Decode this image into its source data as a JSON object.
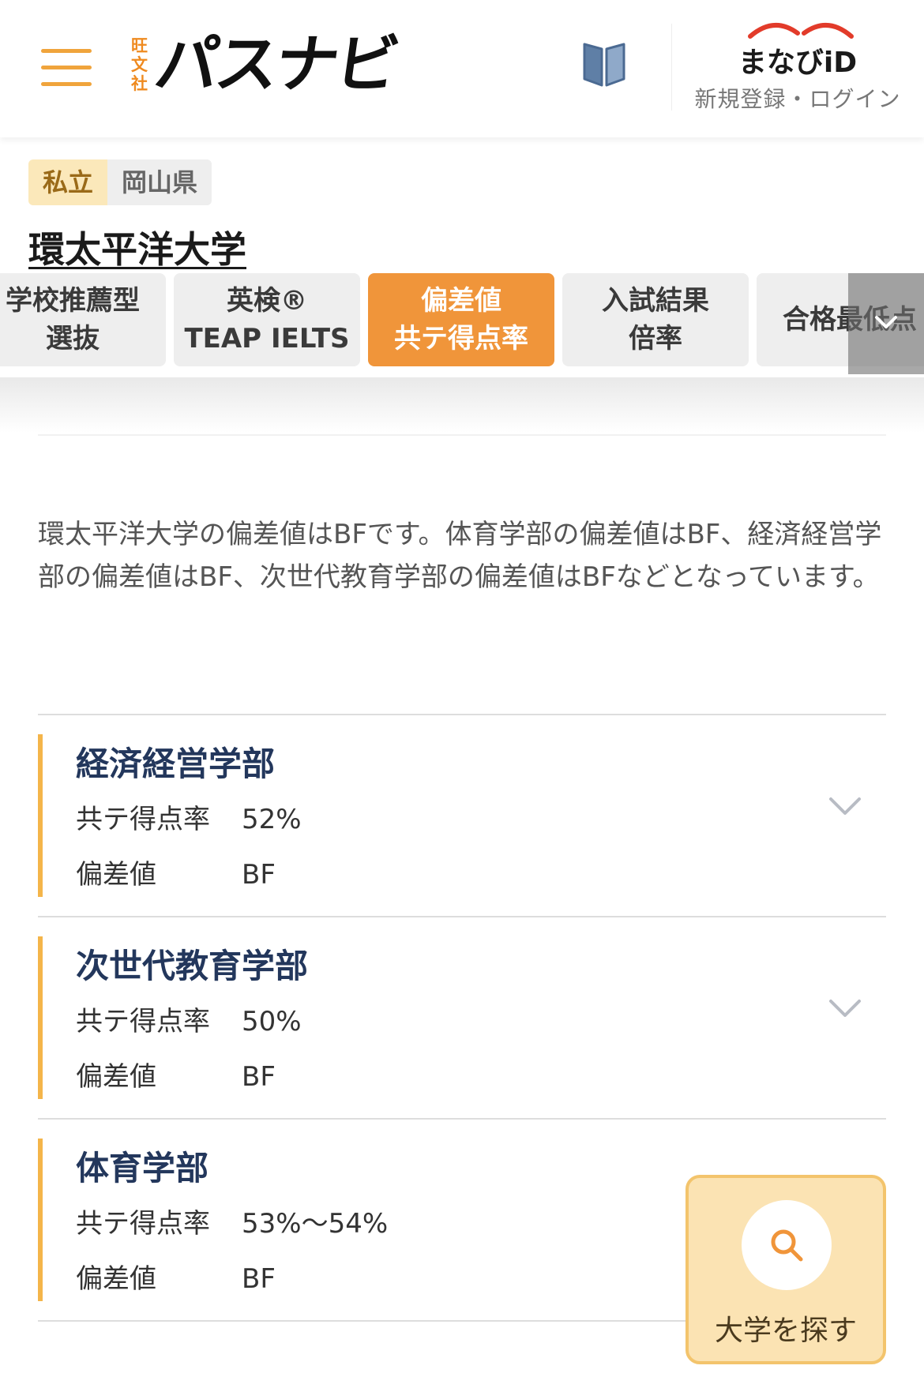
{
  "header": {
    "logo_publisher": [
      "旺",
      "文",
      "社"
    ],
    "logo_main": "パスナビ",
    "manabi_title": "まなびiD",
    "manabi_sub": "新規登録・ログイン",
    "accent_color": "#f0953a"
  },
  "university": {
    "type": "私立",
    "prefecture": "岡山県",
    "name": "環太平洋大学"
  },
  "tabs": [
    {
      "line1": "学校推薦型",
      "line2": "選抜"
    },
    {
      "line1": "英検®",
      "line2": "TEAP IELTS"
    },
    {
      "line1": "偏差値",
      "line2": "共テ得点率",
      "active": true
    },
    {
      "line1": "入試結果",
      "line2": "倍率"
    },
    {
      "line1": "合格最低点",
      "line2": ""
    }
  ],
  "description": "環太平洋大学の偏差値はBFです。体育学部の偏差値はBF、経済経営学部の偏差値はBF、次世代教育学部の偏差値はBFなどとなっています。",
  "faculties": [
    {
      "name": "経済経営学部",
      "score_label": "共テ得点率",
      "score": "52%",
      "dev_label": "偏差値",
      "dev": "BF"
    },
    {
      "name": "次世代教育学部",
      "score_label": "共テ得点率",
      "score": "50%",
      "dev_label": "偏差値",
      "dev": "BF"
    },
    {
      "name": "体育学部",
      "score_label": "共テ得点率",
      "score": "53%〜54%",
      "dev_label": "偏差値",
      "dev": "BF"
    }
  ],
  "search_button": {
    "label": "大学を探す",
    "icon": "search-icon"
  }
}
